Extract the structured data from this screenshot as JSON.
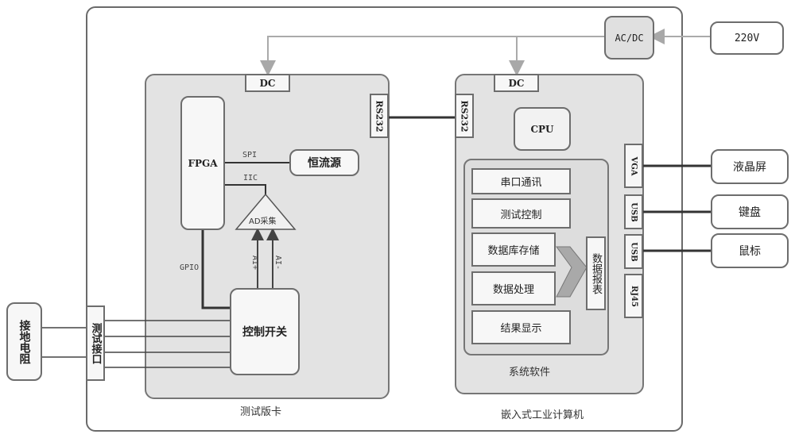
{
  "power": {
    "mains": "220V",
    "converter": "AC/DC"
  },
  "test_board": {
    "caption": "测试版卡",
    "dc": "DC",
    "rs232": "RS232",
    "fpga": "FPGA",
    "spi": "SPI",
    "iic": "IIC",
    "constant_current": "恒流源",
    "ad": "AD采集",
    "ai_plus": "AI+",
    "ai_minus": "AI-",
    "gpio": "GPIO",
    "control_switch": "控制开关"
  },
  "external": {
    "grounding_resistor": "接地电阻",
    "test_interface": "测试接口"
  },
  "computer": {
    "caption": "嵌入式工业计算机",
    "dc": "DC",
    "rs232": "RS232",
    "cpu": "CPU",
    "software": {
      "caption": "系统软件",
      "modules": [
        "串口通讯",
        "测试控制",
        "数据库存储",
        "数据处理",
        "结果显示"
      ],
      "report": "数据报表"
    },
    "ports": [
      "VGA",
      "USB",
      "USB",
      "RJ45"
    ]
  },
  "peripherals": [
    "液晶屏",
    "键盘",
    "鼠标"
  ]
}
